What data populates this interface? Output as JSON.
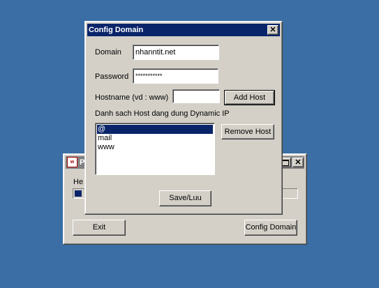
{
  "back_window": {
    "title_partial": "P",
    "label_partial": "He",
    "exit_label": "Exit",
    "config_label": "Config Domain"
  },
  "dialog": {
    "title": "Config Domain",
    "close_glyph": "✕",
    "domain_label": "Domain",
    "domain_value": "nhanntit.net",
    "password_label": "Password",
    "password_value": "***********",
    "hostname_label": "Hostname (vd : www)",
    "hostname_value": "",
    "add_host_label": "Add Host",
    "list_caption": "Danh sach Host dang dung Dynamic IP",
    "hosts": [
      "@",
      "mail",
      "www"
    ],
    "selected_host": "@",
    "remove_host_label": "Remove Host",
    "save_label": "Save/Luu"
  }
}
